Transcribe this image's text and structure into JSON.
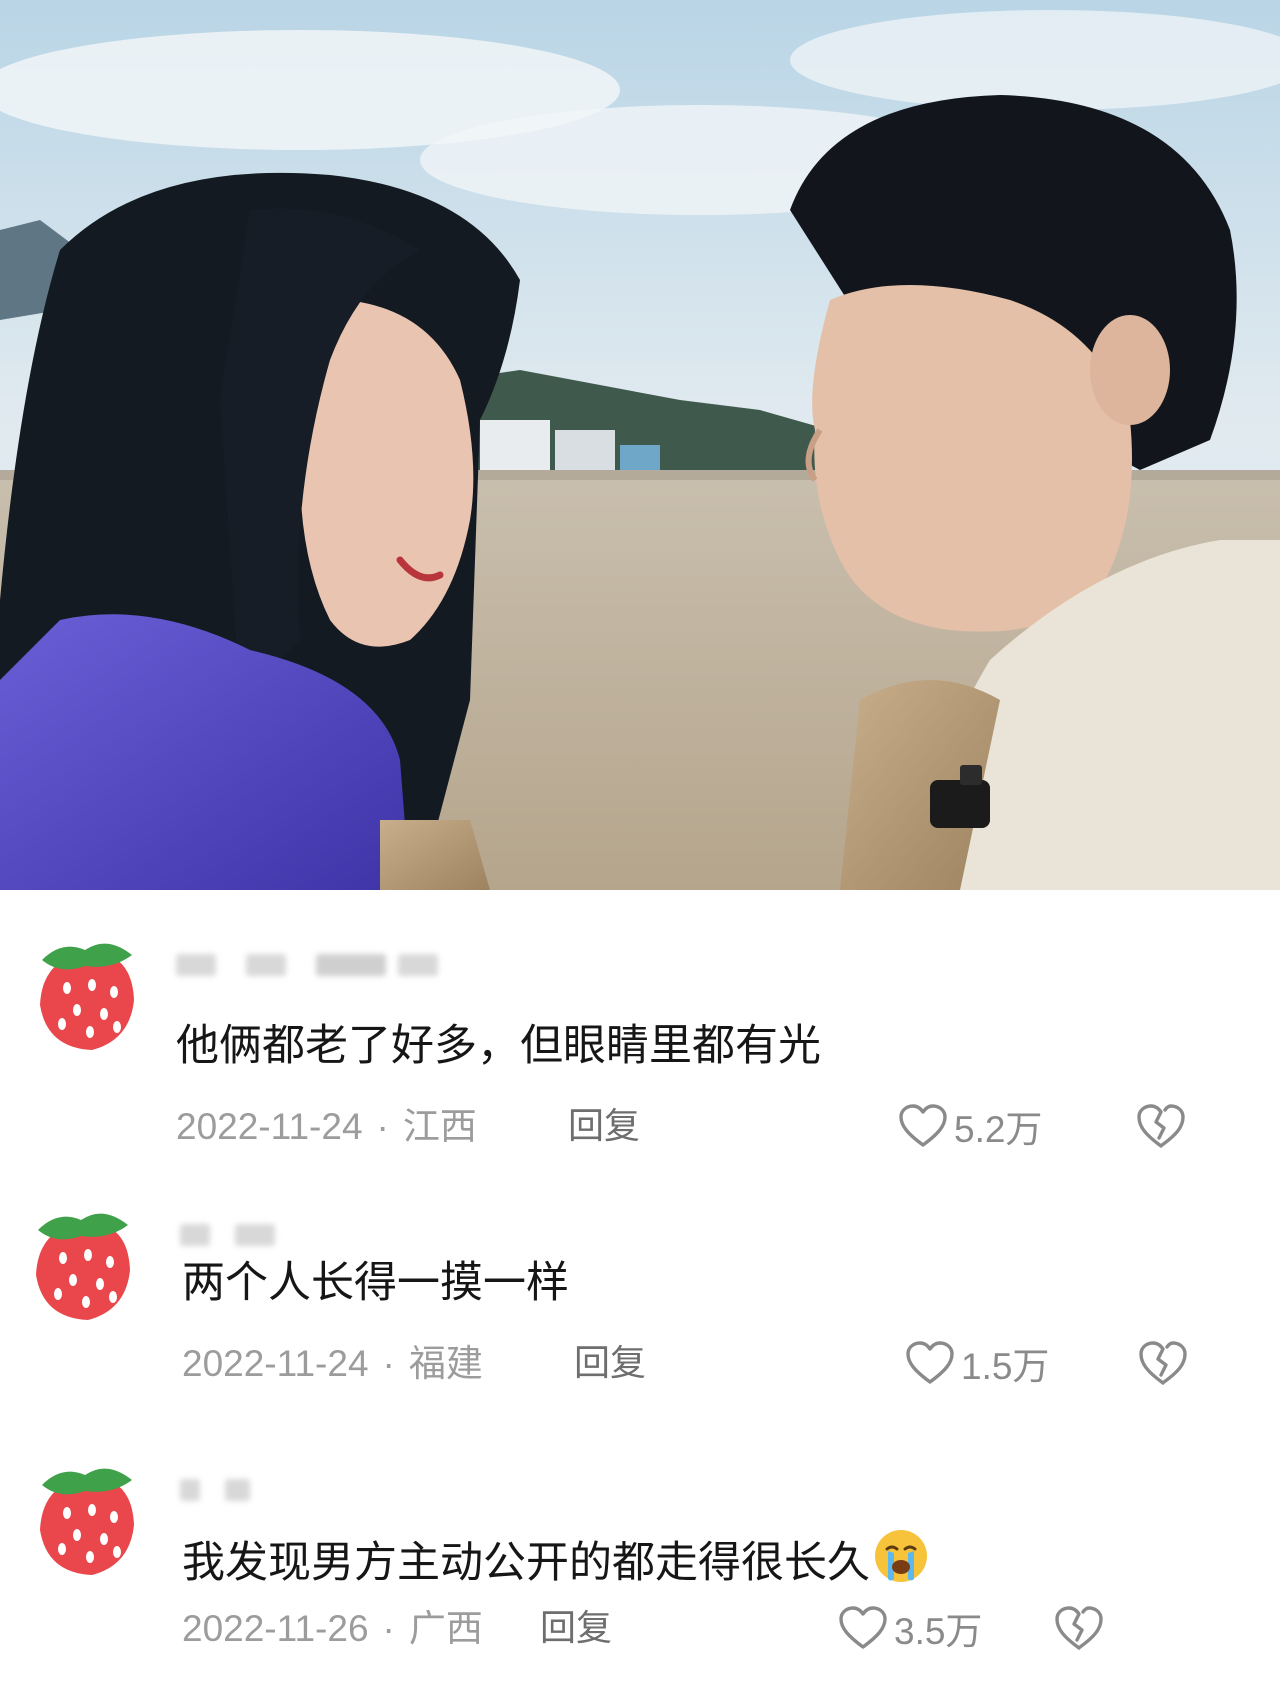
{
  "photo": {
    "description_icon": "couple-photo"
  },
  "comments": [
    {
      "text": "他俩都老了好多，但眼睛里都有光",
      "date": "2022-11-24",
      "separator": "·",
      "region": "江西",
      "reply_label": "回复",
      "likes": "5.2万"
    },
    {
      "text": "两个人长得一摸一样",
      "date": "2022-11-24",
      "separator": "·",
      "region": "福建",
      "reply_label": "回复",
      "likes": "1.5万"
    },
    {
      "text": "我发现男方主动公开的都走得很长久",
      "date": "2022-11-26",
      "separator": "·",
      "region": "广西",
      "reply_label": "回复",
      "likes": "3.5万",
      "emoji": "crying-face-emoji"
    }
  ],
  "colors": {
    "text": "#161616",
    "meta": "#9c9c9c",
    "avatar_red": "#e9474b",
    "avatar_green": "#3fa24a"
  }
}
